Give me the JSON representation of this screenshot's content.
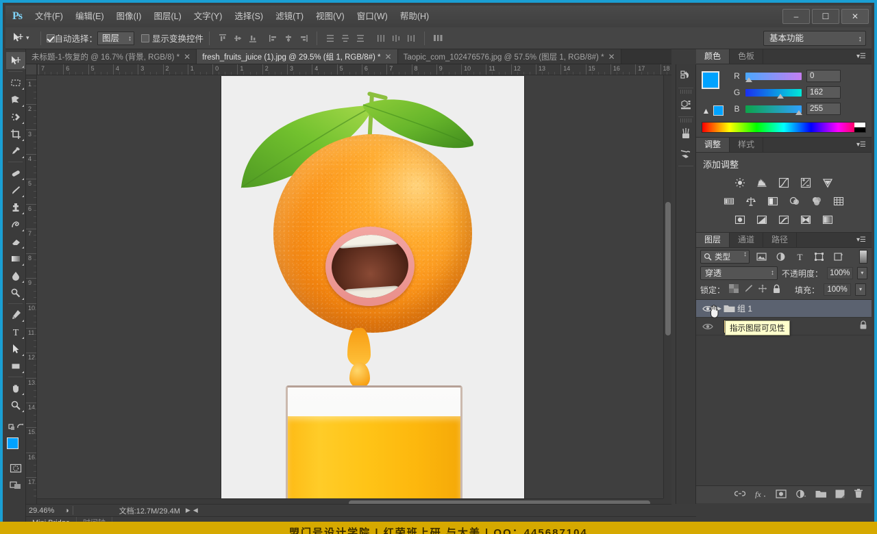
{
  "app": {
    "name": "Ps",
    "logo_text": "Ps"
  },
  "window_controls": {
    "minimize": "–",
    "maximize": "☐",
    "close": "✕"
  },
  "menu": [
    {
      "label": "文件(F)"
    },
    {
      "label": "编辑(E)"
    },
    {
      "label": "图像(I)"
    },
    {
      "label": "图层(L)"
    },
    {
      "label": "文字(Y)"
    },
    {
      "label": "选择(S)"
    },
    {
      "label": "滤镜(T)"
    },
    {
      "label": "视图(V)"
    },
    {
      "label": "窗口(W)"
    },
    {
      "label": "帮助(H)"
    }
  ],
  "options_bar": {
    "auto_select_label": "自动选择：",
    "auto_select_checked": true,
    "auto_select_value": "图层",
    "show_transform_label": "显示变换控件",
    "show_transform_checked": false,
    "workspace": "基本功能"
  },
  "toolbox": [
    {
      "name": "move-tool",
      "active": true
    },
    {
      "name": "marquee-tool",
      "active": false
    },
    {
      "name": "lasso-tool",
      "active": false
    },
    {
      "name": "quick-selection-tool",
      "active": false
    },
    {
      "name": "crop-tool",
      "active": false
    },
    {
      "name": "eyedropper-tool",
      "active": false
    },
    {
      "name": "healing-brush-tool",
      "active": false
    },
    {
      "name": "brush-tool",
      "active": false
    },
    {
      "name": "clone-stamp-tool",
      "active": false
    },
    {
      "name": "history-brush-tool",
      "active": false
    },
    {
      "name": "eraser-tool",
      "active": false
    },
    {
      "name": "gradient-tool",
      "active": false
    },
    {
      "name": "blur-tool",
      "active": false
    },
    {
      "name": "dodge-tool",
      "active": false
    },
    {
      "name": "pen-tool",
      "active": false
    },
    {
      "name": "type-tool",
      "active": false
    },
    {
      "name": "path-selection-tool",
      "active": false
    },
    {
      "name": "rectangle-tool",
      "active": false
    },
    {
      "name": "hand-tool",
      "active": false
    },
    {
      "name": "zoom-tool",
      "active": false
    }
  ],
  "document_tabs": [
    {
      "label": "未标题-1-恢复的 @ 16.7% (背景, RGB/8) *",
      "active": false,
      "close": "✕"
    },
    {
      "label": "fresh_fruits_juice (1).jpg @ 29.5% (组 1, RGB/8#) *",
      "active": true,
      "close": "✕"
    },
    {
      "label": "Taopic_com_102476576.jpg @ 57.5% (图层 1, RGB/8#) *",
      "active": false,
      "close": "✕"
    }
  ],
  "rulers": {
    "horizontal": [
      "7",
      "6",
      "5",
      "4",
      "3",
      "2",
      "1",
      "0",
      "1",
      "2",
      "3",
      "4",
      "5",
      "6",
      "7",
      "8",
      "9",
      "10",
      "11",
      "12",
      "13",
      "14",
      "15",
      "16",
      "17",
      "18"
    ],
    "vertical": [
      "1",
      "2",
      "3",
      "4",
      "5",
      "6",
      "7",
      "8",
      "9",
      "10",
      "11",
      "12",
      "13",
      "14",
      "15",
      "16",
      "17"
    ],
    "unit": "cm"
  },
  "canvas": {
    "artwork_description": "orange-with-mouth-over-juice-glass",
    "background": "#eeeeee"
  },
  "status_bar": {
    "zoom": "29.46%",
    "doc_label": "文档:12.7M/29.4M"
  },
  "bottom_bar": {
    "items": [
      {
        "label": "Mini Bridge",
        "dim": false
      },
      {
        "label": "时间轴",
        "dim": true
      }
    ]
  },
  "color_panel": {
    "tabs": [
      {
        "label": "颜色",
        "active": true
      },
      {
        "label": "色板",
        "active": false
      }
    ],
    "foreground_hex": "#00a2ff",
    "background_hex": "#4a3a21",
    "channels": [
      {
        "label": "R",
        "value": "0",
        "pos_pct": 2
      },
      {
        "label": "G",
        "value": "162",
        "pos_pct": 62
      },
      {
        "label": "B",
        "value": "255",
        "pos_pct": 98
      }
    ]
  },
  "adjustments_panel": {
    "tabs": [
      {
        "label": "调整",
        "active": true
      },
      {
        "label": "样式",
        "active": false
      }
    ],
    "title": "添加调整",
    "rows": [
      [
        "brightness-contrast-icon",
        "levels-icon",
        "curves-icon",
        "exposure-icon",
        "vibrance-icon"
      ],
      [
        "hue-saturation-icon",
        "color-balance-icon",
        "black-white-icon",
        "photo-filter-icon",
        "channel-mixer-icon",
        "color-lookup-icon"
      ],
      [
        "invert-icon",
        "posterize-icon",
        "threshold-icon",
        "gradient-map-icon",
        "selective-color-icon"
      ]
    ]
  },
  "layers_panel": {
    "tabs": [
      {
        "label": "图层",
        "active": true
      },
      {
        "label": "通道",
        "active": false
      },
      {
        "label": "路径",
        "active": false
      }
    ],
    "filter_label": "类型",
    "blend_mode": "穿透",
    "opacity_label": "不透明度：",
    "opacity_value": "100%",
    "lock_label": "锁定：",
    "fill_label": "填充：",
    "fill_value": "100%",
    "layers": [
      {
        "name": "组 1",
        "type": "group",
        "selected": true,
        "visible": true,
        "locked": false
      },
      {
        "name": "",
        "type": "layer",
        "selected": false,
        "visible": true,
        "locked": true
      }
    ],
    "tooltip": "指示图层可见性",
    "footer_icons": [
      "link-icon",
      "fx-icon",
      "mask-icon",
      "adjustment-icon",
      "folder-icon",
      "new-layer-icon",
      "trash-icon"
    ]
  },
  "right_rail": [
    {
      "name": "history-icon"
    },
    {
      "name": "3d-icon"
    },
    {
      "name": "brushes-icon"
    },
    {
      "name": "brush-presets-icon"
    }
  ],
  "banner": {
    "text": "盟门号设计学院  |  红荣班上研  与大美  |  QQ：445687104"
  }
}
